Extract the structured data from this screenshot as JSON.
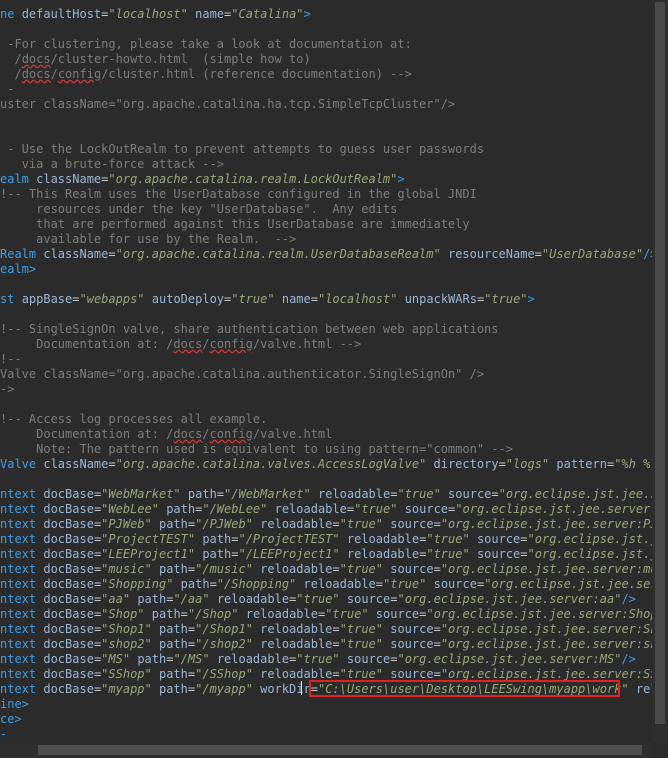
{
  "editor": {
    "colors": {
      "background": "#2b2b2b",
      "tag": "#3c9ee8",
      "attribute": "#9ab7d8",
      "string": "#9aa87b",
      "comment": "#7d7d7d",
      "highlight_box": "#e51f1f"
    },
    "lines": [
      [
        [
          "tag",
          "ne "
        ],
        [
          "attr",
          "defaultHost"
        ],
        [
          "eq",
          "="
        ],
        [
          "val",
          "\"localhost\""
        ],
        [
          "txt",
          " "
        ],
        [
          "attr",
          "name"
        ],
        [
          "eq",
          "="
        ],
        [
          "val",
          "\"Catalina\""
        ],
        [
          "tag",
          ">"
        ]
      ],
      [],
      [
        [
          "cm",
          " -For clustering, please take a look at documentation at:"
        ]
      ],
      [
        [
          "cm",
          "  /"
        ],
        [
          "cmsq",
          "docs"
        ],
        [
          "cm",
          "/cluster-howto.html  (simple how to)"
        ]
      ],
      [
        [
          "cm",
          "  /"
        ],
        [
          "cmsq",
          "docs"
        ],
        [
          "cm",
          "/"
        ],
        [
          "cmsq",
          "config"
        ],
        [
          "cm",
          "/cluster.html (reference documentation) -->"
        ]
      ],
      [
        [
          "cm",
          " -"
        ]
      ],
      [
        [
          "cm",
          "uster className=\"org.apache.catalina.ha.tcp.SimpleTcpCluster\"/>"
        ]
      ],
      [],
      [],
      [
        [
          "cm",
          " - Use the LockOutRealm to prevent attempts to guess user passwords"
        ]
      ],
      [
        [
          "cm",
          "   via a brute-force attack -->"
        ]
      ],
      [
        [
          "tag",
          "ealm "
        ],
        [
          "attr",
          "className"
        ],
        [
          "eq",
          "="
        ],
        [
          "val",
          "\"org.apache.catalina.realm.LockOutRealm\""
        ],
        [
          "tag",
          ">"
        ]
      ],
      [
        [
          "cm",
          "!-- This Realm uses the UserDatabase configured in the global JNDI"
        ]
      ],
      [
        [
          "cm",
          "     resources under the key \"UserDatabase\".  Any edits"
        ]
      ],
      [
        [
          "cm",
          "     that are performed against this UserDatabase are immediately"
        ]
      ],
      [
        [
          "cm",
          "     available for use by the Realm.  -->"
        ]
      ],
      [
        [
          "tag",
          "Realm "
        ],
        [
          "attr",
          "className"
        ],
        [
          "eq",
          "="
        ],
        [
          "val",
          "\"org.apache.catalina.realm.UserDatabaseRealm\""
        ],
        [
          "txt",
          " "
        ],
        [
          "attr",
          "resourceName"
        ],
        [
          "eq",
          "="
        ],
        [
          "val",
          "\"UserDatabase\""
        ],
        [
          "tag",
          "/>"
        ]
      ],
      [
        [
          "tag",
          "ealm>"
        ]
      ],
      [],
      [
        [
          "tag",
          "st "
        ],
        [
          "attr",
          "appBase"
        ],
        [
          "eq",
          "="
        ],
        [
          "val",
          "\"webapps\""
        ],
        [
          "txt",
          " "
        ],
        [
          "attr",
          "autoDeploy"
        ],
        [
          "eq",
          "="
        ],
        [
          "val",
          "\"true\""
        ],
        [
          "txt",
          " "
        ],
        [
          "attr",
          "name"
        ],
        [
          "eq",
          "="
        ],
        [
          "val",
          "\"localhost\""
        ],
        [
          "txt",
          " "
        ],
        [
          "attr",
          "unpackWARs"
        ],
        [
          "eq",
          "="
        ],
        [
          "val",
          "\"true\""
        ],
        [
          "tag",
          ">"
        ]
      ],
      [],
      [
        [
          "cm",
          "!-- SingleSignOn valve, share authentication between web applications"
        ]
      ],
      [
        [
          "cm",
          "     Documentation at: /"
        ],
        [
          "cmsq",
          "docs"
        ],
        [
          "cm",
          "/"
        ],
        [
          "cmsq",
          "config"
        ],
        [
          "cm",
          "/valve.html -->"
        ]
      ],
      [
        [
          "cm",
          "!--"
        ]
      ],
      [
        [
          "cm",
          "Valve className=\"org.apache.catalina.authenticator.SingleSignOn\" />"
        ]
      ],
      [
        [
          "cm",
          "->"
        ]
      ],
      [],
      [
        [
          "cm",
          "!-- Access log processes all example."
        ]
      ],
      [
        [
          "cm",
          "     Documentation at: /"
        ],
        [
          "cmsq",
          "docs"
        ],
        [
          "cm",
          "/"
        ],
        [
          "cmsq",
          "config"
        ],
        [
          "cm",
          "/valve.html"
        ]
      ],
      [
        [
          "cm",
          "     Note: The pattern used is equivalent to using pattern=\"common\" -->"
        ]
      ],
      [
        [
          "tag",
          "Valve "
        ],
        [
          "attr",
          "className"
        ],
        [
          "eq",
          "="
        ],
        [
          "val",
          "\"org.apache.catalina.valves.AccessLogValve\""
        ],
        [
          "txt",
          " "
        ],
        [
          "attr",
          "directory"
        ],
        [
          "eq",
          "="
        ],
        [
          "val",
          "\"logs\""
        ],
        [
          "txt",
          " "
        ],
        [
          "attr",
          "pattern"
        ],
        [
          "eq",
          "="
        ],
        [
          "val",
          "\"%h %l %"
        ]
      ],
      [],
      [
        [
          "tag",
          "ntext "
        ],
        [
          "attr",
          "docBase"
        ],
        [
          "eq",
          "="
        ],
        [
          "val",
          "\"WebMarket\""
        ],
        [
          "txt",
          " "
        ],
        [
          "attr",
          "path"
        ],
        [
          "eq",
          "="
        ],
        [
          "val",
          "\"/WebMarket\""
        ],
        [
          "txt",
          " "
        ],
        [
          "attr",
          "reloadable"
        ],
        [
          "eq",
          "="
        ],
        [
          "val",
          "\"true\""
        ],
        [
          "txt",
          " "
        ],
        [
          "attr",
          "source"
        ],
        [
          "eq",
          "="
        ],
        [
          "val",
          "\"org.eclipse.jst.jee.ser"
        ]
      ],
      [
        [
          "tag",
          "ntext "
        ],
        [
          "attr",
          "docBase"
        ],
        [
          "eq",
          "="
        ],
        [
          "val",
          "\"WebLee\""
        ],
        [
          "txt",
          " "
        ],
        [
          "attr",
          "path"
        ],
        [
          "eq",
          "="
        ],
        [
          "val",
          "\"/WebLee\""
        ],
        [
          "txt",
          " "
        ],
        [
          "attr",
          "reloadable"
        ],
        [
          "eq",
          "="
        ],
        [
          "val",
          "\"true\""
        ],
        [
          "txt",
          " "
        ],
        [
          "attr",
          "source"
        ],
        [
          "eq",
          "="
        ],
        [
          "val",
          "\"org.eclipse.jst.jee.server:We"
        ]
      ],
      [
        [
          "tag",
          "ntext "
        ],
        [
          "attr",
          "docBase"
        ],
        [
          "eq",
          "="
        ],
        [
          "val",
          "\"PJWeb\""
        ],
        [
          "txt",
          " "
        ],
        [
          "attr",
          "path"
        ],
        [
          "eq",
          "="
        ],
        [
          "val",
          "\"/PJWeb\""
        ],
        [
          "txt",
          " "
        ],
        [
          "attr",
          "reloadable"
        ],
        [
          "eq",
          "="
        ],
        [
          "val",
          "\"true\""
        ],
        [
          "txt",
          " "
        ],
        [
          "attr",
          "source"
        ],
        [
          "eq",
          "="
        ],
        [
          "val",
          "\"org.eclipse.jst.jee.server:PJWe"
        ]
      ],
      [
        [
          "tag",
          "ntext "
        ],
        [
          "attr",
          "docBase"
        ],
        [
          "eq",
          "="
        ],
        [
          "val",
          "\"ProjectTEST\""
        ],
        [
          "txt",
          " "
        ],
        [
          "attr",
          "path"
        ],
        [
          "eq",
          "="
        ],
        [
          "val",
          "\"/ProjectTEST\""
        ],
        [
          "txt",
          " "
        ],
        [
          "attr",
          "reloadable"
        ],
        [
          "eq",
          "="
        ],
        [
          "val",
          "\"true\""
        ],
        [
          "txt",
          " "
        ],
        [
          "attr",
          "source"
        ],
        [
          "eq",
          "="
        ],
        [
          "val",
          "\"org.eclipse.jst.jee"
        ]
      ],
      [
        [
          "tag",
          "ntext "
        ],
        [
          "attr",
          "docBase"
        ],
        [
          "eq",
          "="
        ],
        [
          "val",
          "\"LEEProject1\""
        ],
        [
          "txt",
          " "
        ],
        [
          "attr",
          "path"
        ],
        [
          "eq",
          "="
        ],
        [
          "val",
          "\"/LEEProject1\""
        ],
        [
          "txt",
          " "
        ],
        [
          "attr",
          "reloadable"
        ],
        [
          "eq",
          "="
        ],
        [
          "val",
          "\"true\""
        ],
        [
          "txt",
          " "
        ],
        [
          "attr",
          "source"
        ],
        [
          "eq",
          "="
        ],
        [
          "val",
          "\"org.eclipse.jst.jee"
        ]
      ],
      [
        [
          "tag",
          "ntext "
        ],
        [
          "attr",
          "docBase"
        ],
        [
          "eq",
          "="
        ],
        [
          "val",
          "\"music\""
        ],
        [
          "txt",
          " "
        ],
        [
          "attr",
          "path"
        ],
        [
          "eq",
          "="
        ],
        [
          "val",
          "\"/music\""
        ],
        [
          "txt",
          " "
        ],
        [
          "attr",
          "reloadable"
        ],
        [
          "eq",
          "="
        ],
        [
          "val",
          "\"true\""
        ],
        [
          "txt",
          " "
        ],
        [
          "attr",
          "source"
        ],
        [
          "eq",
          "="
        ],
        [
          "val",
          "\"org.eclipse.jst.jee.server:musi"
        ]
      ],
      [
        [
          "tag",
          "ntext "
        ],
        [
          "attr",
          "docBase"
        ],
        [
          "eq",
          "="
        ],
        [
          "val",
          "\"Shopping\""
        ],
        [
          "txt",
          " "
        ],
        [
          "attr",
          "path"
        ],
        [
          "eq",
          "="
        ],
        [
          "val",
          "\"/Shopping\""
        ],
        [
          "txt",
          " "
        ],
        [
          "attr",
          "reloadable"
        ],
        [
          "eq",
          "="
        ],
        [
          "val",
          "\"true\""
        ],
        [
          "txt",
          " "
        ],
        [
          "attr",
          "source"
        ],
        [
          "eq",
          "="
        ],
        [
          "val",
          "\"org.eclipse.jst.jee.serve"
        ]
      ],
      [
        [
          "tag",
          "ntext "
        ],
        [
          "attr",
          "docBase"
        ],
        [
          "eq",
          "="
        ],
        [
          "val",
          "\"aa\""
        ],
        [
          "txt",
          " "
        ],
        [
          "attr",
          "path"
        ],
        [
          "eq",
          "="
        ],
        [
          "val",
          "\"/aa\""
        ],
        [
          "txt",
          " "
        ],
        [
          "attr",
          "reloadable"
        ],
        [
          "eq",
          "="
        ],
        [
          "val",
          "\"true\""
        ],
        [
          "txt",
          " "
        ],
        [
          "attr",
          "source"
        ],
        [
          "eq",
          "="
        ],
        [
          "val",
          "\"org.eclipse.jst.jee.server:aa\""
        ],
        [
          "tag",
          "/>"
        ]
      ],
      [
        [
          "tag",
          "ntext "
        ],
        [
          "attr",
          "docBase"
        ],
        [
          "eq",
          "="
        ],
        [
          "val",
          "\"Shop\""
        ],
        [
          "txt",
          " "
        ],
        [
          "attr",
          "path"
        ],
        [
          "eq",
          "="
        ],
        [
          "val",
          "\"/Shop\""
        ],
        [
          "txt",
          " "
        ],
        [
          "attr",
          "reloadable"
        ],
        [
          "eq",
          "="
        ],
        [
          "val",
          "\"true\""
        ],
        [
          "txt",
          " "
        ],
        [
          "attr",
          "source"
        ],
        [
          "eq",
          "="
        ],
        [
          "val",
          "\"org.eclipse.jst.jee.server:Shop\""
        ]
      ],
      [
        [
          "tag",
          "ntext "
        ],
        [
          "attr",
          "docBase"
        ],
        [
          "eq",
          "="
        ],
        [
          "val",
          "\"Shop1\""
        ],
        [
          "txt",
          " "
        ],
        [
          "attr",
          "path"
        ],
        [
          "eq",
          "="
        ],
        [
          "val",
          "\"/Shop1\""
        ],
        [
          "txt",
          " "
        ],
        [
          "attr",
          "reloadable"
        ],
        [
          "eq",
          "="
        ],
        [
          "val",
          "\"true\""
        ],
        [
          "txt",
          " "
        ],
        [
          "attr",
          "source"
        ],
        [
          "eq",
          "="
        ],
        [
          "val",
          "\"org.eclipse.jst.jee.server:Shop"
        ]
      ],
      [
        [
          "tag",
          "ntext "
        ],
        [
          "attr",
          "docBase"
        ],
        [
          "eq",
          "="
        ],
        [
          "val",
          "\"shop2\""
        ],
        [
          "txt",
          " "
        ],
        [
          "attr",
          "path"
        ],
        [
          "eq",
          "="
        ],
        [
          "val",
          "\"/shop2\""
        ],
        [
          "txt",
          " "
        ],
        [
          "attr",
          "reloadable"
        ],
        [
          "eq",
          "="
        ],
        [
          "val",
          "\"true\""
        ],
        [
          "txt",
          " "
        ],
        [
          "attr",
          "source"
        ],
        [
          "eq",
          "="
        ],
        [
          "val",
          "\"org.eclipse.jst.jee.server:shop"
        ]
      ],
      [
        [
          "tag",
          "ntext "
        ],
        [
          "attr",
          "docBase"
        ],
        [
          "eq",
          "="
        ],
        [
          "val",
          "\"MS\""
        ],
        [
          "txt",
          " "
        ],
        [
          "attr",
          "path"
        ],
        [
          "eq",
          "="
        ],
        [
          "val",
          "\"/MS\""
        ],
        [
          "txt",
          " "
        ],
        [
          "attr",
          "reloadable"
        ],
        [
          "eq",
          "="
        ],
        [
          "val",
          "\"true\""
        ],
        [
          "txt",
          " "
        ],
        [
          "attr",
          "source"
        ],
        [
          "eq",
          "="
        ],
        [
          "val",
          "\"org.eclipse.jst.jee.server:MS\""
        ],
        [
          "tag",
          "/>"
        ]
      ],
      [
        [
          "tag",
          "ntext "
        ],
        [
          "attr",
          "docBase"
        ],
        [
          "eq",
          "="
        ],
        [
          "val",
          "\"SShop\""
        ],
        [
          "txt",
          " "
        ],
        [
          "attr",
          "path"
        ],
        [
          "eq",
          "="
        ],
        [
          "val",
          "\"/SShop\""
        ],
        [
          "txt",
          " "
        ],
        [
          "attr",
          "reloadable"
        ],
        [
          "eq",
          "="
        ],
        [
          "val",
          "\"true\""
        ],
        [
          "txt",
          " "
        ],
        [
          "attr",
          "source"
        ],
        [
          "eq",
          "="
        ],
        [
          "val",
          "\"org.eclipse.jst.jee.server:SSho"
        ]
      ],
      [
        [
          "tag",
          "ntext "
        ],
        [
          "attr",
          "docBase"
        ],
        [
          "eq",
          "="
        ],
        [
          "val",
          "\"myapp\""
        ],
        [
          "txt",
          " "
        ],
        [
          "attr",
          "path"
        ],
        [
          "eq",
          "="
        ],
        [
          "val",
          "\"/myapp\""
        ],
        [
          "txt",
          " "
        ],
        [
          "attr",
          "workDir"
        ],
        [
          "eq",
          "="
        ],
        [
          "val",
          "\"C:\\Users\\user\\Desktop\\LEESwing\\myapp\\work\""
        ],
        [
          "txt",
          " "
        ],
        [
          "attr",
          "reloa"
        ]
      ],
      [
        [
          "tag",
          "ine>"
        ]
      ],
      [
        [
          "tag",
          "ce>"
        ]
      ],
      [
        [
          "tag",
          "-"
        ]
      ]
    ]
  }
}
